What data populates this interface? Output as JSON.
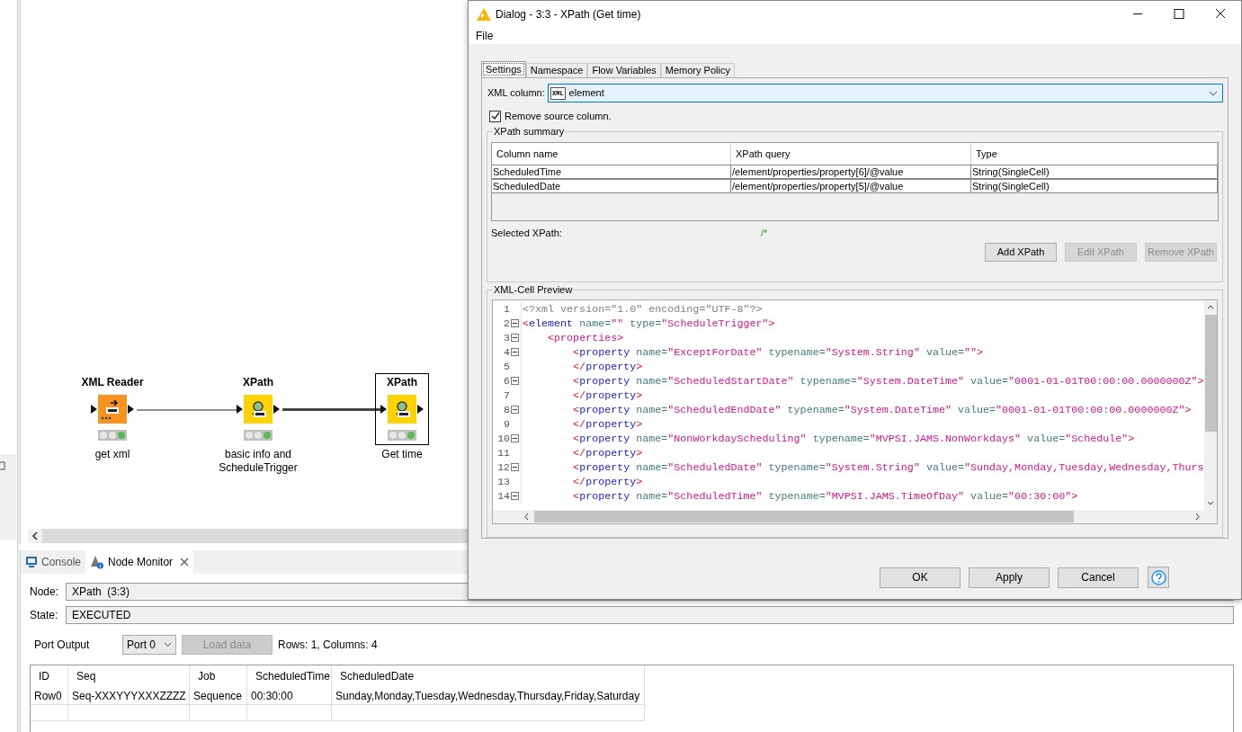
{
  "canvas": {
    "nodes": [
      {
        "kind": "reader",
        "title": "XML Reader",
        "label": "get xml",
        "executed": true,
        "selected": false
      },
      {
        "kind": "xpath",
        "title": "XPath",
        "label": "basic info and ScheduleTrigger",
        "executed": true,
        "selected": false
      },
      {
        "kind": "xpath",
        "title": "XPath",
        "label": "Get time",
        "executed": true,
        "selected": true
      }
    ],
    "connections": [
      {
        "highlighted": false
      },
      {
        "highlighted": true
      }
    ]
  },
  "monitor": {
    "tabs": [
      {
        "label": "Console",
        "selected": false,
        "closable": false
      },
      {
        "label": "Node Monitor",
        "selected": true,
        "closable": true
      }
    ],
    "node_label": "Node:",
    "node_value": "XPath  (3:3)",
    "state_label": "State:",
    "state_value": "EXECUTED",
    "port_label": "Port Output",
    "port_select": "Port 0",
    "load_button": {
      "label": "Load data",
      "disabled": true
    },
    "summary": "Rows: 1, Columns: 4",
    "table": {
      "columns": [
        "ID",
        "Seq",
        "Job",
        "ScheduledTime",
        "ScheduledDate"
      ],
      "rows": [
        [
          "Row0",
          "Seq-XXXYYYXXXZZZZ",
          "Sequence",
          "00:30:00",
          "Sunday,Monday,Tuesday,Wednesday,Thursday,Friday,Saturday"
        ]
      ]
    }
  },
  "dialog": {
    "title": "Dialog - 3:3 - XPath (Get time)",
    "menu": [
      "File"
    ],
    "tabs": [
      {
        "label": "Settings",
        "selected": true
      },
      {
        "label": "Namespace",
        "selected": false
      },
      {
        "label": "Flow Variables",
        "selected": false
      },
      {
        "label": "Memory Policy",
        "selected": false
      }
    ],
    "xml_column": {
      "label": "XML column:",
      "badge": "XML",
      "value": "element"
    },
    "remove_source": {
      "label": "Remove source column.",
      "checked": true
    },
    "summary": {
      "title": "XPath summary",
      "columns": [
        "Column name",
        "XPath query",
        "Type"
      ],
      "rows": [
        [
          "ScheduledTime",
          "/element/properties/property[6]/@value",
          "String(SingleCell)"
        ],
        [
          "ScheduledDate",
          "/element/properties/property[5]/@value",
          "String(SingleCell)"
        ]
      ],
      "selected_label": "Selected XPath:",
      "selected_value": "/*",
      "buttons": [
        {
          "label": "Add XPath",
          "disabled": false
        },
        {
          "label": "Edit XPath",
          "disabled": true
        },
        {
          "label": "Remove XPath",
          "disabled": true
        }
      ]
    },
    "preview": {
      "title": "XML-Cell Preview",
      "lines": [
        {
          "n": "1",
          "fold": false,
          "tokens": [
            {
              "kind": "decl",
              "text": "<?xml version=\"1.0\" encoding=\"UTF-8\"?>"
            }
          ]
        },
        {
          "n": "2",
          "fold": true,
          "tokens": [
            {
              "kind": "punct",
              "text": "<"
            },
            {
              "kind": "tag",
              "text": "element"
            },
            {
              "kind": "attr",
              "text": " name="
            },
            {
              "kind": "value",
              "text": "\"\""
            },
            {
              "kind": "attr",
              "text": " type="
            },
            {
              "kind": "value",
              "text": "\"ScheduleTrigger\""
            },
            {
              "kind": "punct",
              "text": ">"
            }
          ]
        },
        {
          "n": "3",
          "fold": true,
          "tokens": [
            {
              "kind": "punct",
              "text": "    <"
            },
            {
              "kind": "value",
              "text": "properties"
            },
            {
              "kind": "punct",
              "text": ">"
            }
          ]
        },
        {
          "n": "4",
          "fold": true,
          "tokens": [
            {
              "kind": "punct",
              "text": "        <"
            },
            {
              "kind": "tag",
              "text": "property"
            },
            {
              "kind": "attr",
              "text": " name="
            },
            {
              "kind": "value",
              "text": "\"ExceptForDate\""
            },
            {
              "kind": "attr",
              "text": " typename="
            },
            {
              "kind": "value",
              "text": "\"System.String\""
            },
            {
              "kind": "attr",
              "text": " value="
            },
            {
              "kind": "value",
              "text": "\"\""
            },
            {
              "kind": "punct",
              "text": ">"
            }
          ]
        },
        {
          "n": "5",
          "fold": false,
          "tokens": [
            {
              "kind": "punct",
              "text": "        </"
            },
            {
              "kind": "tag",
              "text": "property"
            },
            {
              "kind": "punct",
              "text": ">"
            }
          ]
        },
        {
          "n": "6",
          "fold": true,
          "tokens": [
            {
              "kind": "punct",
              "text": "        <"
            },
            {
              "kind": "tag",
              "text": "property"
            },
            {
              "kind": "attr",
              "text": " name="
            },
            {
              "kind": "value",
              "text": "\"ScheduledStartDate\""
            },
            {
              "kind": "attr",
              "text": " typename="
            },
            {
              "kind": "value",
              "text": "\"System.DateTime\""
            },
            {
              "kind": "attr",
              "text": " value="
            },
            {
              "kind": "value",
              "text": "\"0001-01-01T00:00:00.0000000Z\""
            },
            {
              "kind": "punct",
              "text": ">"
            }
          ]
        },
        {
          "n": "7",
          "fold": false,
          "tokens": [
            {
              "kind": "punct",
              "text": "        </"
            },
            {
              "kind": "tag",
              "text": "property"
            },
            {
              "kind": "punct",
              "text": ">"
            }
          ]
        },
        {
          "n": "8",
          "fold": true,
          "tokens": [
            {
              "kind": "punct",
              "text": "        <"
            },
            {
              "kind": "tag",
              "text": "property"
            },
            {
              "kind": "attr",
              "text": " name="
            },
            {
              "kind": "value",
              "text": "\"ScheduledEndDate\""
            },
            {
              "kind": "attr",
              "text": " typename="
            },
            {
              "kind": "value",
              "text": "\"System.DateTime\""
            },
            {
              "kind": "attr",
              "text": " value="
            },
            {
              "kind": "value",
              "text": "\"0001-01-01T00:00:00.0000000Z\""
            },
            {
              "kind": "punct",
              "text": ">"
            }
          ]
        },
        {
          "n": "9",
          "fold": false,
          "tokens": [
            {
              "kind": "punct",
              "text": "        </"
            },
            {
              "kind": "tag",
              "text": "property"
            },
            {
              "kind": "punct",
              "text": ">"
            }
          ]
        },
        {
          "n": "10",
          "fold": true,
          "tokens": [
            {
              "kind": "punct",
              "text": "        <"
            },
            {
              "kind": "tag",
              "text": "property"
            },
            {
              "kind": "attr",
              "text": " name="
            },
            {
              "kind": "value",
              "text": "\"NonWorkdayScheduling\""
            },
            {
              "kind": "attr",
              "text": " typename="
            },
            {
              "kind": "value",
              "text": "\"MVPSI.JAMS.NonWorkdays\""
            },
            {
              "kind": "attr",
              "text": " value="
            },
            {
              "kind": "value",
              "text": "\"Schedule\""
            },
            {
              "kind": "punct",
              "text": ">"
            }
          ]
        },
        {
          "n": "11",
          "fold": false,
          "tokens": [
            {
              "kind": "punct",
              "text": "        </"
            },
            {
              "kind": "tag",
              "text": "property"
            },
            {
              "kind": "punct",
              "text": ">"
            }
          ]
        },
        {
          "n": "12",
          "fold": true,
          "tokens": [
            {
              "kind": "punct",
              "text": "        <"
            },
            {
              "kind": "tag",
              "text": "property"
            },
            {
              "kind": "attr",
              "text": " name="
            },
            {
              "kind": "value",
              "text": "\"ScheduledDate\""
            },
            {
              "kind": "attr",
              "text": " typename="
            },
            {
              "kind": "value",
              "text": "\"System.String\""
            },
            {
              "kind": "attr",
              "text": " value="
            },
            {
              "kind": "value",
              "text": "\"Sunday,Monday,Tuesday,Wednesday,Thurs"
            }
          ]
        },
        {
          "n": "13",
          "fold": false,
          "tokens": [
            {
              "kind": "punct",
              "text": "        </"
            },
            {
              "kind": "tag",
              "text": "property"
            },
            {
              "kind": "punct",
              "text": ">"
            }
          ]
        },
        {
          "n": "14",
          "fold": true,
          "tokens": [
            {
              "kind": "punct",
              "text": "        <"
            },
            {
              "kind": "tag",
              "text": "property"
            },
            {
              "kind": "attr",
              "text": " name="
            },
            {
              "kind": "value",
              "text": "\"ScheduledTime\""
            },
            {
              "kind": "attr",
              "text": " typename="
            },
            {
              "kind": "value",
              "text": "\"MVPSI.JAMS.TimeOfDay\""
            },
            {
              "kind": "attr",
              "text": " value="
            },
            {
              "kind": "value",
              "text": "\"00:30:00\""
            },
            {
              "kind": "punct",
              "text": ">"
            }
          ]
        }
      ]
    },
    "buttons": [
      {
        "label": "OK"
      },
      {
        "label": "Apply"
      },
      {
        "label": "Cancel"
      }
    ]
  }
}
